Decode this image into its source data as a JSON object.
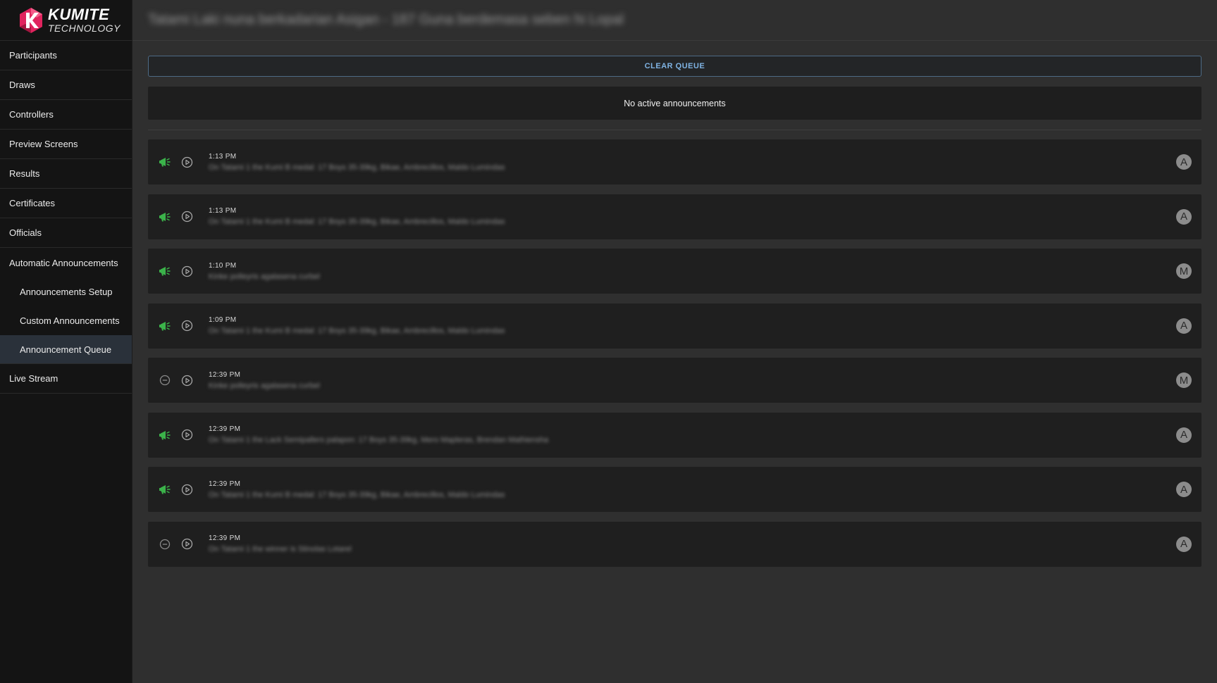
{
  "brand": {
    "title": "KUMITE",
    "subtitle": "TECHNOLOGY",
    "color_primary": "#e0245e"
  },
  "header": {
    "title": "Tatami Laki nuna berkadarian Asigan - 187 Guna berdemasa seben hi Lopal"
  },
  "sidebar": {
    "items": [
      {
        "label": "Participants"
      },
      {
        "label": "Draws"
      },
      {
        "label": "Controllers"
      },
      {
        "label": "Preview Screens"
      },
      {
        "label": "Results"
      },
      {
        "label": "Certificates"
      },
      {
        "label": "Officials"
      },
      {
        "label": "Automatic Announcements"
      }
    ],
    "sub_items": [
      {
        "label": "Announcements Setup"
      },
      {
        "label": "Custom Announcements"
      },
      {
        "label": "Announcement Queue",
        "active": true
      }
    ],
    "last_item": {
      "label": "Live Stream"
    }
  },
  "main": {
    "clear_label": "CLEAR QUEUE",
    "empty_label": "No active announcements",
    "accent_color": "#7fb3e3",
    "announce_icon_color": "#3bb34a"
  },
  "queue": [
    {
      "time": "1:13 PM",
      "message": "On Tatami 1 the Kumi B medal: 17 Boys 35-39kg, Bikae, Ambrecillos, Maldo Lumindas",
      "status": "announced",
      "badge": "A"
    },
    {
      "time": "1:13 PM",
      "message": "On Tatami 1 the Kumi B medal: 17 Boys 35-39kg, Bikae, Ambrecillos, Maldo Lumindas",
      "status": "announced",
      "badge": "A"
    },
    {
      "time": "1:10 PM",
      "message": "Kinke polleyris agalasena curbel",
      "status": "announced",
      "badge": "M"
    },
    {
      "time": "1:09 PM",
      "message": "On Tatami 1 the Kumi B medal: 17 Boys 35-39kg, Bikae, Ambrecillos, Maldo Lumindas",
      "status": "announced",
      "badge": "A"
    },
    {
      "time": "12:39 PM",
      "message": "Kinke polleyris agalasena curbel",
      "status": "skipped",
      "badge": "M"
    },
    {
      "time": "12:39 PM",
      "message": "On Tatami 1 the Lack Semipallers palapon: 17 Boys 35-39kg, Mero Mapleras, Brendan Mathiensha",
      "status": "announced",
      "badge": "A"
    },
    {
      "time": "12:39 PM",
      "message": "On Tatami 1 the Kumi B medal: 17 Boys 35-39kg, Bikae, Ambrecillos, Maldo Lumindas",
      "status": "announced",
      "badge": "A"
    },
    {
      "time": "12:39 PM",
      "message": "On Tatami 1 the winner is Stinolas Lotarel",
      "status": "skipped",
      "badge": "A"
    }
  ]
}
